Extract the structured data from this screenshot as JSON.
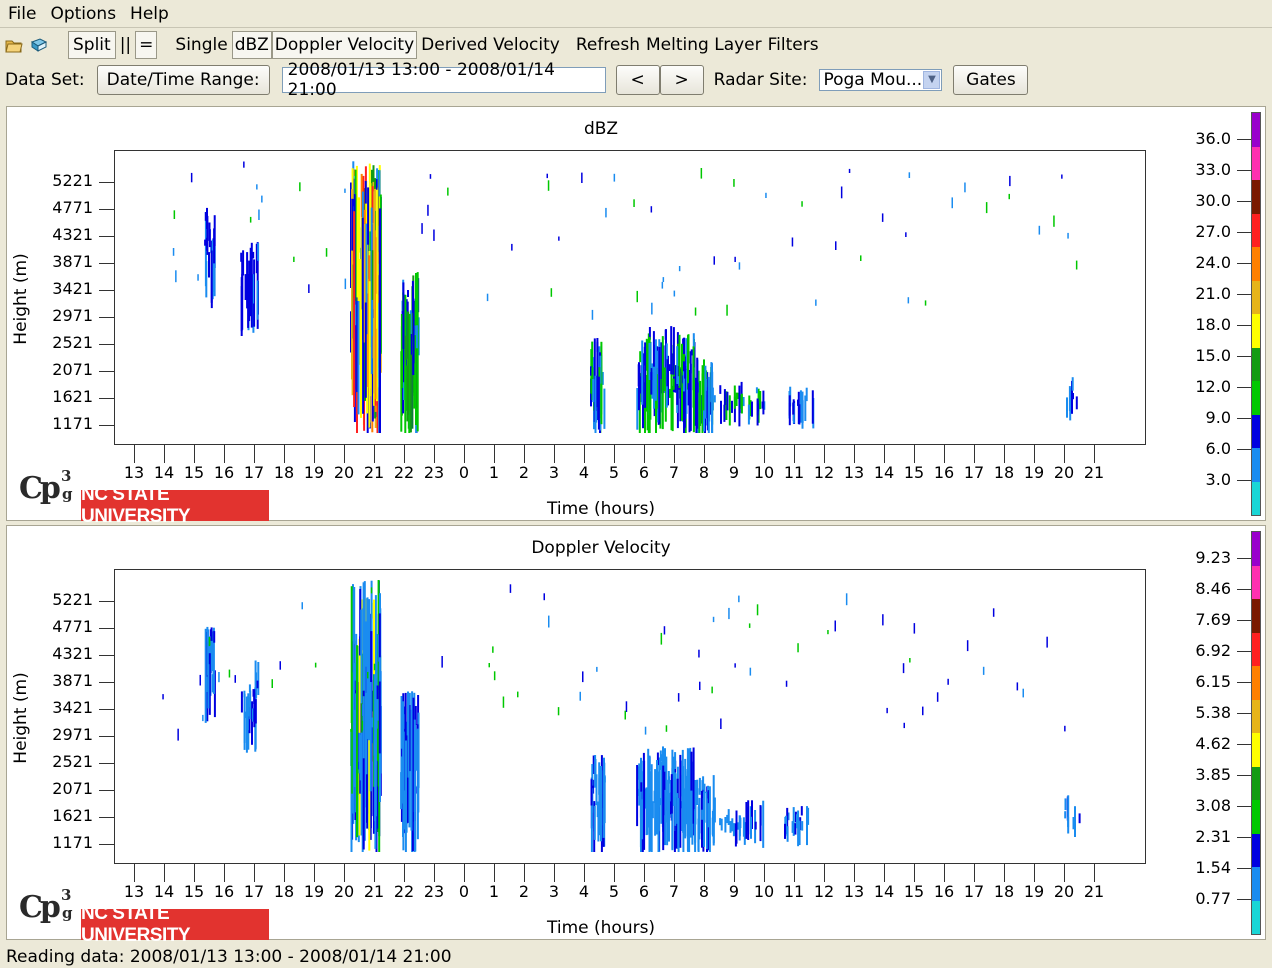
{
  "menu": {
    "file": "File",
    "options": "Options",
    "help": "Help"
  },
  "toolbar": {
    "split": "Split",
    "vertical": "||",
    "horizontal": "=",
    "single": "Single",
    "dbz": "dBZ",
    "doppler": "Doppler Velocity",
    "derived": "Derived Velocity",
    "refresh": "Refresh",
    "melting": "Melting Layer",
    "filters": "Filters"
  },
  "dataset": {
    "label": "Data Set:",
    "range_button": "Date/Time Range:",
    "range_value": "2008/01/13 13:00 - 2008/01/14 21:00",
    "prev": "<",
    "next": ">",
    "site_label": "Radar Site:",
    "site_value": "Poga Mou...",
    "gates": "Gates"
  },
  "panels": [
    {
      "title": "dBZ",
      "ylabel": "Height (m)",
      "xlabel": "Time (hours)",
      "yticks": [
        "5221",
        "4771",
        "4321",
        "3871",
        "3421",
        "2971",
        "2521",
        "2071",
        "1621",
        "1171"
      ],
      "xticks": [
        "13",
        "14",
        "15",
        "16",
        "17",
        "18",
        "19",
        "20",
        "21",
        "22",
        "23",
        "0",
        "1",
        "2",
        "3",
        "4",
        "5",
        "6",
        "7",
        "8",
        "9",
        "10",
        "11",
        "12",
        "13",
        "14",
        "15",
        "16",
        "17",
        "18",
        "19",
        "20",
        "21"
      ],
      "colorbar_labels": [
        "36.0",
        "33.0",
        "30.0",
        "27.0",
        "24.0",
        "21.0",
        "18.0",
        "15.0",
        "12.0",
        "9.0",
        "6.0",
        "3.0"
      ]
    },
    {
      "title": "Doppler Velocity",
      "ylabel": "Height (m)",
      "xlabel": "Time (hours)",
      "yticks": [
        "5221",
        "4771",
        "4321",
        "3871",
        "3421",
        "2971",
        "2521",
        "2071",
        "1621",
        "1171"
      ],
      "xticks": [
        "13",
        "14",
        "15",
        "16",
        "17",
        "18",
        "19",
        "20",
        "21",
        "22",
        "23",
        "0",
        "1",
        "2",
        "3",
        "4",
        "5",
        "6",
        "7",
        "8",
        "9",
        "10",
        "11",
        "12",
        "13",
        "14",
        "15",
        "16",
        "17",
        "18",
        "19",
        "20",
        "21"
      ],
      "colorbar_labels": [
        "9.23",
        "8.46",
        "7.69",
        "6.92",
        "6.15",
        "5.38",
        "4.62",
        "3.85",
        "3.08",
        "2.31",
        "1.54",
        "0.77"
      ]
    }
  ],
  "logos": {
    "cp3": "Cp",
    "cp3_sup": "3",
    "cp3_sub": "g",
    "ncsu": "NC STATE UNIVERSITY"
  },
  "colorbar_colors": [
    "#1ad6d6",
    "#1a8cf0",
    "#0000e0",
    "#00c800",
    "#139b13",
    "#ffff00",
    "#e6b41a",
    "#ff8000",
    "#ff2020",
    "#7a1a00",
    "#ff30b0",
    "#9900cc"
  ],
  "status": "Reading data: 2008/01/13 13:00 - 2008/01/14 21:00"
}
